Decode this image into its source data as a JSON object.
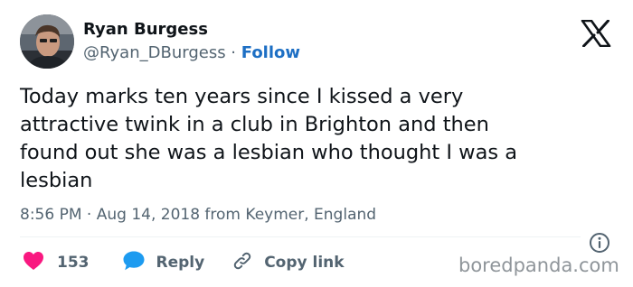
{
  "user": {
    "display_name": "Ryan Burgess",
    "handle": "@Ryan_DBurgess",
    "separator": " · ",
    "follow_label": "Follow"
  },
  "tweet": {
    "text": "Today marks ten years since I kissed a very\nattractive twink in a club in Brighton and then\nfound out she was a lesbian who thought I was a\nlesbian",
    "time": "8:56 PM",
    "separator": " · ",
    "date": "Aug 14, 2018",
    "location_prefix": " from ",
    "location": "Keymer, England"
  },
  "actions": {
    "like_count": "153",
    "reply_label": "Reply",
    "copy_link_label": "Copy link"
  },
  "icons": {
    "brand": "x-logo-icon",
    "info": "info-icon",
    "like": "heart-icon",
    "reply": "speech-bubble-icon",
    "copy": "link-icon"
  },
  "colors": {
    "like": "#f91880",
    "reply": "#1d9bf0",
    "follow": "#1d6fc4",
    "secondary_text": "#536471",
    "watermark": "#8f959a"
  },
  "watermark": "boredpanda.com"
}
